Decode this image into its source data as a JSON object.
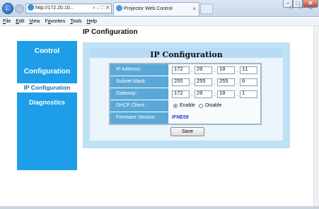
{
  "browser": {
    "address": "http://172.20.10...",
    "address_controls": "⌕ ↓ ⬚ ✕",
    "tab_title": "Projector Web Control",
    "tab_close": "×",
    "window_controls": {
      "min": "–",
      "max": "□",
      "close": "✕"
    },
    "menu": [
      "File",
      "Edit",
      "View",
      "Favorites",
      "Tools",
      "Help"
    ]
  },
  "page": {
    "title": "IP Configuration"
  },
  "sidebar": {
    "items": [
      {
        "label": "Control"
      },
      {
        "label": "Configuration"
      },
      {
        "label": "IP Configuration"
      },
      {
        "label": "Diagnostics"
      }
    ]
  },
  "panel": {
    "title": "IP Configuration",
    "ip_label": "IP Address:",
    "ip": [
      "172",
      "20",
      "10",
      "11"
    ],
    "mask_label": "Subnet Mask:",
    "mask": [
      "255",
      "255",
      "255",
      "0"
    ],
    "gw_label": "Gateway:",
    "gw": [
      "172",
      "20",
      "10",
      "1"
    ],
    "dhcp_label": "DHCP Client :",
    "dhcp_enable": "Enable",
    "dhcp_disable": "Disable",
    "fw_label": "Firmware Version:",
    "fw_value": "IFNE09",
    "save_label": "Save",
    "dot": "."
  },
  "colors": {
    "sidebar": "#1e9ee8",
    "panel": "#bfe1f5",
    "label_bg": "#5aa8d8",
    "firmware": "#1a3fd1"
  }
}
